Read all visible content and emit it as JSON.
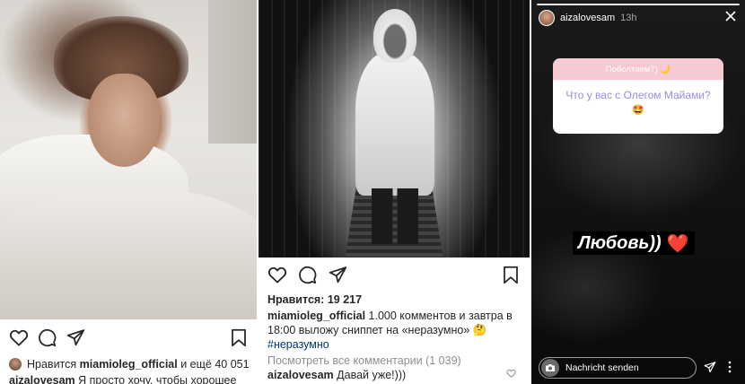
{
  "post1": {
    "likes_prefix": "Нравится",
    "likes_user": "miamioleg_official",
    "likes_suffix": "и ещё 40 051",
    "caption_user": "aizalovesam",
    "caption_text": "Я просто хочу, чтобы хорошее"
  },
  "post2": {
    "likes_label": "Нравится: 19 217",
    "caption_user": "miamioleg_official",
    "caption_text_1": "1.000 комментов и завтра в",
    "caption_text_2": "18:00 выложу сниппет на «неразумно» 🤔",
    "hashtag": "#неразумно",
    "view_comments": "Посмотреть все комментарии (1 039)",
    "comment_user": "aizalovesam",
    "comment_text": "Давай уже!)))"
  },
  "story": {
    "username": "aizalovesam",
    "time": "13h",
    "question_header": "Поболтаем?) 🌙",
    "question_text": "Что у вас с Олегом Майами?",
    "question_emoji": "🤩",
    "answer_text": "Любовь))",
    "answer_emoji": "❤️",
    "reply_placeholder": "Nachricht senden"
  },
  "colors": {
    "text": "#262626",
    "link": "#00376b",
    "muted": "#8e8e8e",
    "question_header_bg": "#f6c9d3",
    "question_text": "#9b8be0",
    "heart": "#e8212e"
  },
  "icons": [
    "heart-icon",
    "comment-icon",
    "share-icon",
    "bookmark-icon",
    "close-icon",
    "camera-icon",
    "send-icon",
    "more-icon"
  ]
}
